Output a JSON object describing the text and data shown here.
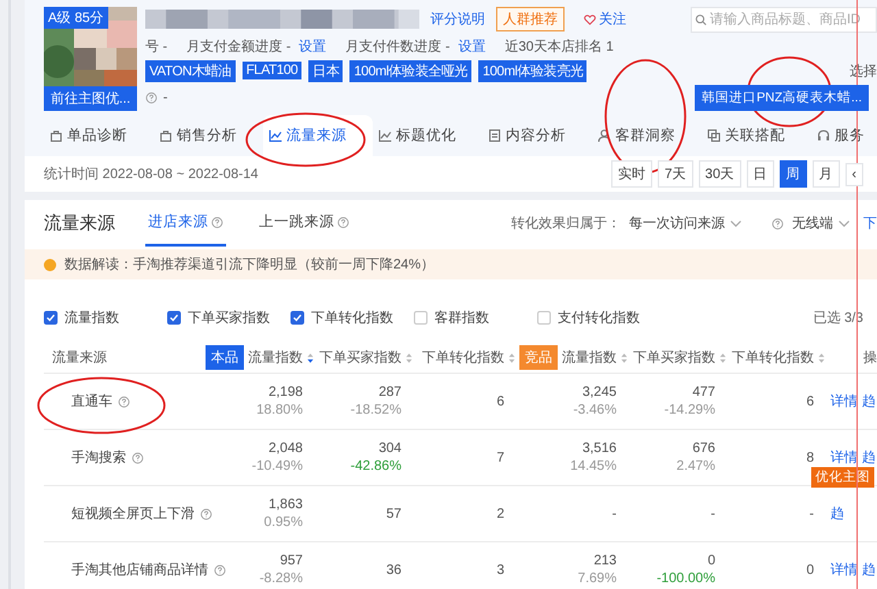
{
  "product": {
    "grade": "A级 85分",
    "go_button": "前往主图优..."
  },
  "header": {
    "score_link": "评分说明",
    "crowd_button": "人群推荐",
    "follow": "关注",
    "search": {
      "placeholder": "请输入商品标题、商品ID"
    }
  },
  "info": [
    {
      "label": "号 -"
    },
    {
      "label": "月支付金额进度 -",
      "link": "设置"
    },
    {
      "label": "月支付件数进度 -",
      "link": "设置"
    },
    {
      "label": "近30天本店排名 1"
    }
  ],
  "tags": [
    "VATON木蜡油",
    "FLAT100",
    "日本",
    "100ml体验装全哑光",
    "100ml体验装亮光"
  ],
  "choose_label": "选择",
  "extra_value": "-",
  "compare_button": "韩国进口PNZ高硬表木蜡...",
  "tabs": [
    {
      "label": "单品诊断",
      "selected": false
    },
    {
      "label": "销售分析",
      "selected": false
    },
    {
      "label": "流量来源",
      "selected": true
    },
    {
      "label": "标题优化",
      "selected": false
    },
    {
      "label": "内容分析",
      "selected": false
    },
    {
      "label": "客群洞察",
      "selected": false
    },
    {
      "label": "关联搭配",
      "selected": false
    },
    {
      "label": "服务",
      "selected": false
    }
  ],
  "period": {
    "text": "统计时间 2022-08-08 ~ 2022-08-14",
    "buttons": [
      {
        "label": "实时",
        "selected": false
      },
      {
        "label": "7天",
        "selected": false
      },
      {
        "label": "30天",
        "selected": false
      },
      {
        "label": "日",
        "selected": false
      },
      {
        "label": "周",
        "selected": true
      },
      {
        "label": "月",
        "selected": false
      },
      {
        "label": "‹",
        "selected": false
      }
    ]
  },
  "section": {
    "title": "流量来源",
    "subtabs": [
      {
        "label": "进店来源",
        "selected": true
      },
      {
        "label": "上一跳来源",
        "selected": false
      }
    ],
    "attribution_label": "转化效果归属于：",
    "attribution_value": "每一次访问来源",
    "device_value": "无线端",
    "download": "下"
  },
  "alert": "数据解读：手淘推荐渠道引流下降明显（较前一周下降24%）",
  "metrics": [
    {
      "label": "流量指数",
      "checked": true
    },
    {
      "label": "下单买家指数",
      "checked": true
    },
    {
      "label": "下单转化指数",
      "checked": true
    },
    {
      "label": "客群指数",
      "checked": false
    },
    {
      "label": "支付转化指数",
      "checked": false
    }
  ],
  "selected_count": "已选 3/3",
  "table": {
    "columns": [
      {
        "label": "流量来源"
      },
      {
        "badge": "本品",
        "kind": "own",
        "label": "流量指数"
      },
      {
        "label": "下单买家指数"
      },
      {
        "label": "下单转化指数"
      },
      {
        "badge": "竞品",
        "kind": "rival",
        "label": "流量指数"
      },
      {
        "label": "下单买家指数"
      },
      {
        "label": "下单转化指数"
      },
      {
        "label": "操"
      }
    ],
    "rows": [
      {
        "cells": [
          {
            "kind": "source",
            "value": "直通车"
          },
          {
            "value": "2,198",
            "change": "18.80%",
            "alert": false
          },
          {
            "value": "287",
            "change": "-18.52%",
            "alert": false
          },
          {
            "value": "6"
          },
          {
            "value": "3,245",
            "change": "-3.46%",
            "alert": false
          },
          {
            "value": "477",
            "change": "-14.29%",
            "alert": false
          },
          {
            "value": "6"
          },
          {
            "kind": "actions",
            "actions": [
              "详情",
              "趋"
            ]
          }
        ]
      },
      {
        "cells": [
          {
            "kind": "source",
            "value": "手淘搜索"
          },
          {
            "value": "2,048",
            "change": "-10.49%",
            "alert": false
          },
          {
            "value": "304",
            "change": "-42.86%",
            "alert": true
          },
          {
            "value": "7"
          },
          {
            "value": "3,516",
            "change": "14.45%",
            "alert": false
          },
          {
            "value": "676",
            "change": "2.47%",
            "alert": false
          },
          {
            "value": "8"
          },
          {
            "kind": "actions",
            "actions": [
              "详情",
              "趋"
            ],
            "badge": "优化主图"
          }
        ]
      },
      {
        "cells": [
          {
            "kind": "source",
            "value": "短视频全屏页上下滑"
          },
          {
            "value": "1,863",
            "change": "0.95%",
            "alert": false
          },
          {
            "value": "57"
          },
          {
            "value": "2"
          },
          {
            "value": "-"
          },
          {
            "value": "-"
          },
          {
            "value": "-"
          },
          {
            "kind": "actions",
            "actions": [
              "趋"
            ]
          }
        ]
      },
      {
        "cells": [
          {
            "kind": "source",
            "value": "手淘其他店铺商品详情"
          },
          {
            "value": "957",
            "change": "-8.28%",
            "alert": false
          },
          {
            "value": "36"
          },
          {
            "value": "3"
          },
          {
            "value": "213",
            "change": "7.69%",
            "alert": false
          },
          {
            "value": "0",
            "change": "-100.00%",
            "alert": true
          },
          {
            "value": "0"
          },
          {
            "kind": "actions",
            "actions": [
              "详情",
              "趋"
            ]
          }
        ]
      }
    ]
  },
  "annotations": [
    {
      "kind": "ellipse"
    },
    {
      "kind": "ellipse"
    },
    {
      "kind": "ellipse"
    },
    {
      "kind": "ellipse"
    },
    {
      "kind": "line"
    }
  ]
}
